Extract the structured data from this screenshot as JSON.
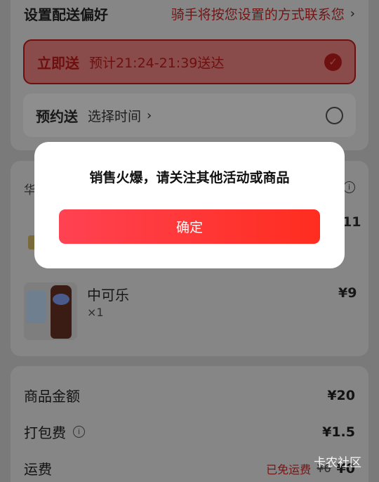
{
  "delivery_pref": {
    "title": "设置配送偏好",
    "hint": "骑手将按您设置的方式联系您",
    "chevron": "›"
  },
  "options": {
    "instant": {
      "title": "立即送",
      "desc": "预计21:24-21:39送达",
      "check": "✓"
    },
    "schedule": {
      "title": "预约送",
      "desc": "选择时间",
      "chevron": "›"
    }
  },
  "store": {
    "name_fragment": "华",
    "price_fragment": "11"
  },
  "item": {
    "name": "中可乐",
    "qty": "×1",
    "price": "¥9"
  },
  "fees": {
    "goods_label": "商品金额",
    "goods_value": "¥20",
    "pack_label": "打包费",
    "pack_value": "¥1.5",
    "ship_label": "运费",
    "ship_waived": "已免运费",
    "ship_orig": "¥6",
    "ship_value": "¥0",
    "info_glyph": "i"
  },
  "dialog": {
    "message": "销售火爆，请关注其他活动或商品",
    "confirm": "确定"
  },
  "watermark": "卡农社区",
  "colors": {
    "accent": "#ff3b3b",
    "overlay": "rgba(0,0,0,0.5)"
  }
}
